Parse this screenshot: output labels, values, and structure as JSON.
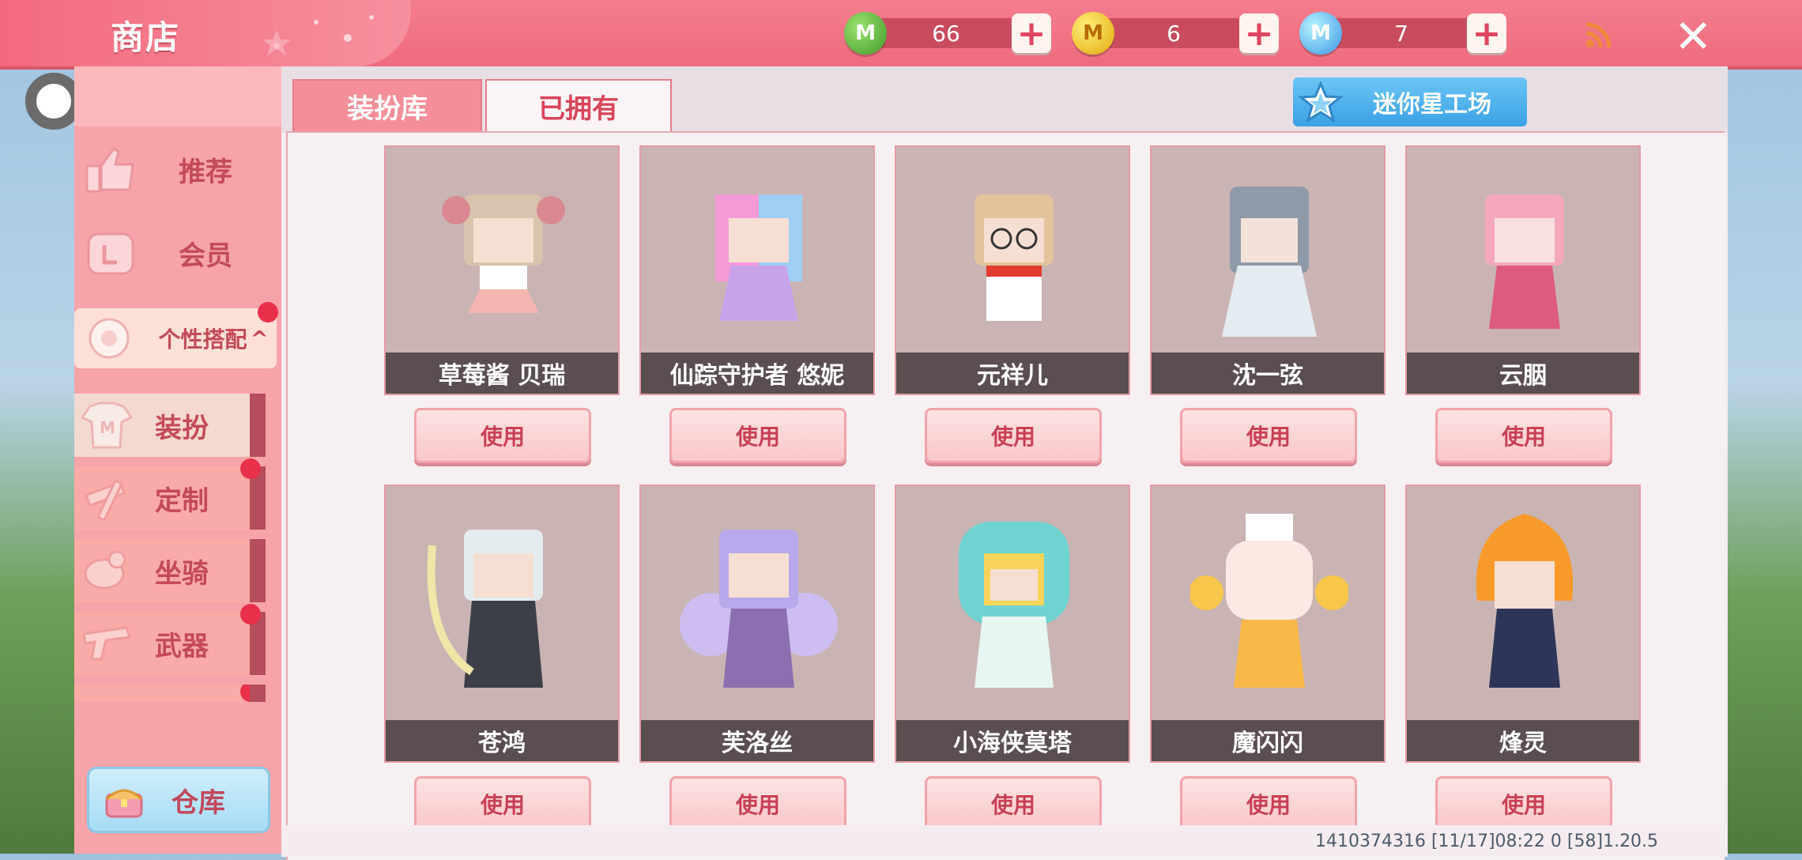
{
  "header": {
    "title": "商店",
    "currencies": [
      {
        "icon": "green-m-coin-icon",
        "letter": "M",
        "amount": "66"
      },
      {
        "icon": "gold-m-coin-icon",
        "letter": "M",
        "amount": "6"
      },
      {
        "icon": "blue-m-coin-icon",
        "letter": "M",
        "amount": "7"
      }
    ],
    "plus": "+",
    "close": "✕"
  },
  "sidebar": {
    "items": [
      {
        "label": "推荐",
        "icon": "thumbs-up-icon"
      },
      {
        "label": "会员",
        "icon": "member-card-icon"
      },
      {
        "label": "个性搭配",
        "caret": "^",
        "icon": "style-icon"
      }
    ],
    "subitems": [
      {
        "label": "装扮",
        "icon": "tshirt-icon"
      },
      {
        "label": "定制",
        "icon": "pencil-ruler-icon"
      },
      {
        "label": "坐骑",
        "icon": "mount-icon"
      },
      {
        "label": "武器",
        "icon": "gun-icon"
      }
    ],
    "warehouse": "仓库"
  },
  "main": {
    "tabs": [
      "装扮库",
      "已拥有"
    ],
    "mini_button": "迷你星工场",
    "cards": [
      {
        "name": "草莓酱 贝瑞",
        "button": "使用"
      },
      {
        "name": "仙踪守护者 悠妮",
        "button": "使用"
      },
      {
        "name": "元祥儿",
        "button": "使用"
      },
      {
        "name": "沈一弦",
        "button": "使用"
      },
      {
        "name": "云胭",
        "button": "使用"
      },
      {
        "name": "苍鸿",
        "button": "使用"
      },
      {
        "name": "芙洛丝",
        "button": "使用"
      },
      {
        "name": "小海侠莫塔",
        "button": "使用"
      },
      {
        "name": "魔闪闪",
        "button": "使用"
      },
      {
        "name": "烽灵",
        "button": "使用"
      }
    ]
  },
  "footer": {
    "info": "1410374316   [11/17]08:22 0   [58]1.20.5"
  },
  "colors": {
    "brand_pink": "#f47d8e",
    "sidebar_pink": "#f6a4a9",
    "accent_red": "#d8455a",
    "blue_button": "#3aa1e4"
  }
}
